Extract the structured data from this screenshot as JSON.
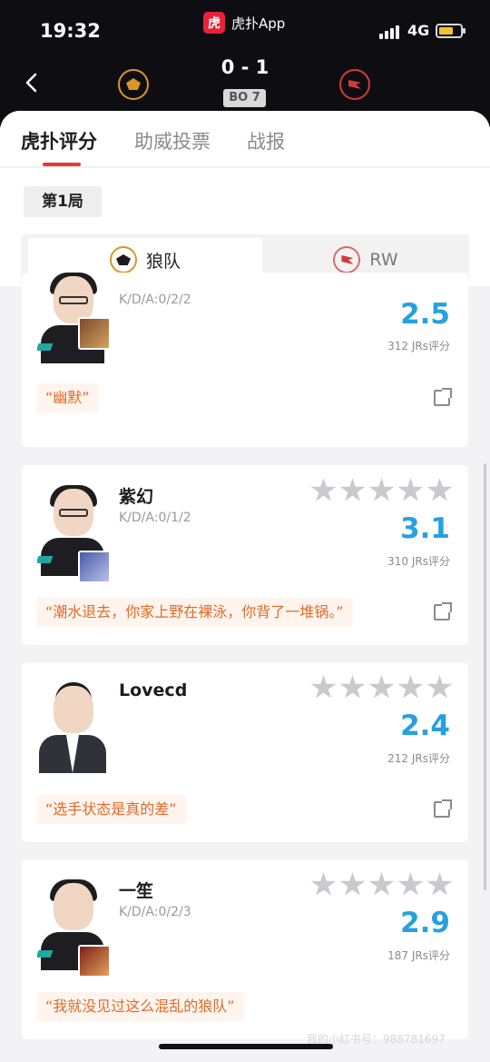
{
  "status": {
    "time": "19:32",
    "network": "4G"
  },
  "app": {
    "logo_char": "虎",
    "title": "虎扑App"
  },
  "match": {
    "score": "0 - 1",
    "format": "BO 7"
  },
  "tabs": [
    {
      "label": "虎扑评分",
      "active": true
    },
    {
      "label": "助威投票",
      "active": false
    },
    {
      "label": "战报",
      "active": false
    }
  ],
  "round": "第1局",
  "teams": [
    {
      "name": "狼队",
      "selected": true
    },
    {
      "name": "RW",
      "selected": false
    }
  ],
  "players": [
    {
      "name": "",
      "kda": "K/D/A:0/2/2",
      "score": "2.5",
      "votes": "312 JRs评分",
      "quote": "“幽默”"
    },
    {
      "name": "紫幻",
      "kda": "K/D/A:0/1/2",
      "score": "3.1",
      "votes": "310 JRs评分",
      "quote": "“潮水退去，你家上野在裸泳，你背了一堆锅。”"
    },
    {
      "name": "Lovecd",
      "kda": "",
      "score": "2.4",
      "votes": "212 JRs评分",
      "quote": "“选手状态是真的差”"
    },
    {
      "name": "一笙",
      "kda": "K/D/A:0/2/3",
      "score": "2.9",
      "votes": "187 JRs评分",
      "quote": "“我就没见过这么混乱的狼队”"
    }
  ],
  "watermark": "我的小红书号：988781697",
  "colors": {
    "accent_red": "#e23a3a",
    "score_blue": "#27a0e0",
    "quote_orange": "#e06a2a"
  }
}
